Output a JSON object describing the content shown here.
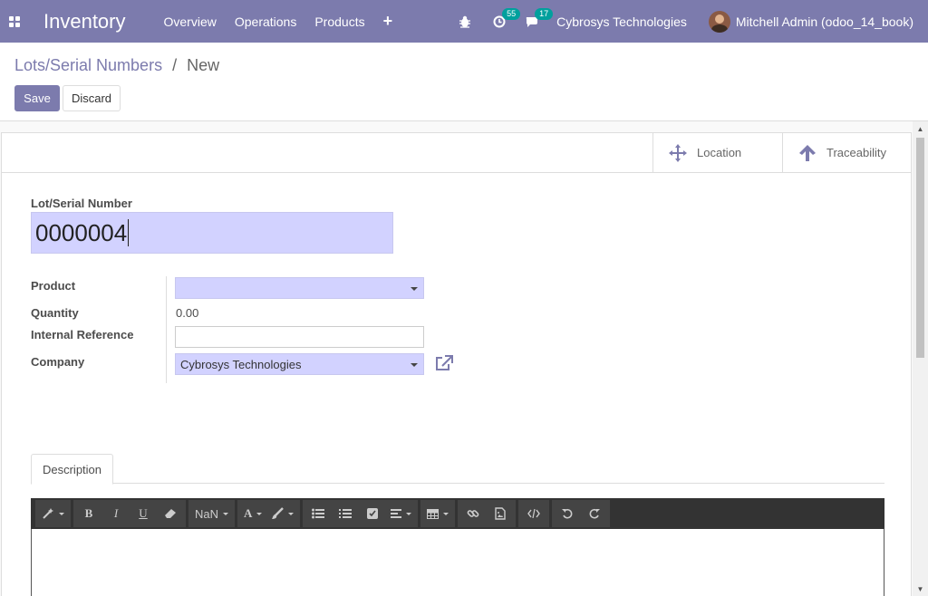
{
  "navbar": {
    "app_name": "Inventory",
    "menu": [
      "Overview",
      "Operations",
      "Products"
    ],
    "plus": "+",
    "activity_count": "55",
    "message_count": "17",
    "company": "Cybrosys Technologies",
    "user": "Mitchell Admin (odoo_14_book)",
    "bg_color": "#7c7bad",
    "badge_color": "#00a09d"
  },
  "breadcrumb": {
    "parent": "Lots/Serial Numbers",
    "separator": "/",
    "current": "New"
  },
  "buttons": {
    "save": "Save",
    "discard": "Discard"
  },
  "smart_buttons": {
    "location": "Location",
    "traceability": "Traceability"
  },
  "form": {
    "lot_label": "Lot/Serial Number",
    "lot_value": "0000004",
    "product_label": "Product",
    "product_value": "",
    "quantity_label": "Quantity",
    "quantity_value": "0.00",
    "internal_ref_label": "Internal Reference",
    "internal_ref_value": "",
    "company_label": "Company",
    "company_value": "Cybrosys Technologies",
    "required_field_color": "#d2d2ff"
  },
  "notebook": {
    "tab_description": "Description"
  },
  "editor": {
    "font_size": "NaN",
    "bold": "B",
    "italic": "I",
    "underline": "U",
    "font_color": "A"
  }
}
